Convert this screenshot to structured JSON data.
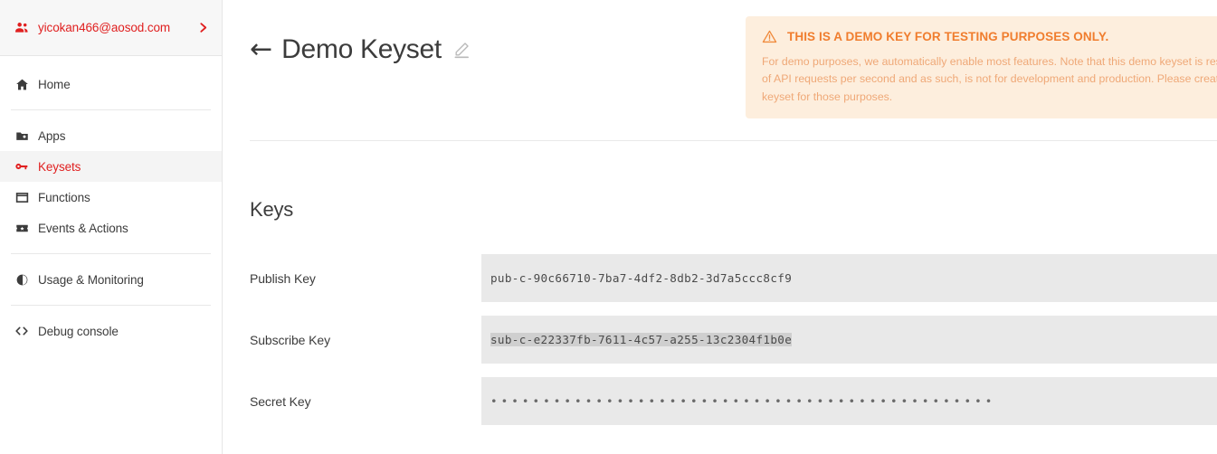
{
  "sidebar": {
    "account": {
      "icon": "people-icon",
      "email": "yicokan466@aosod.com",
      "chevron": "chevron-right-icon"
    },
    "items": [
      {
        "label": "Home",
        "icon": "home-icon",
        "active": false
      },
      {
        "label": "Apps",
        "icon": "folder-icon",
        "active": false
      },
      {
        "label": "Keysets",
        "icon": "key-icon",
        "active": true
      },
      {
        "label": "Functions",
        "icon": "window-icon",
        "active": false
      },
      {
        "label": "Events & Actions",
        "icon": "events-icon",
        "active": false
      },
      {
        "label": "Usage & Monitoring",
        "icon": "pie-chart-icon",
        "active": false
      },
      {
        "label": "Debug console",
        "icon": "code-brackets-icon",
        "active": false
      }
    ]
  },
  "main": {
    "back_arrow": "←",
    "page_title": "Demo Keyset",
    "edit_icon": "pencil-icon",
    "banner": {
      "icon": "warning-triangle-icon",
      "title": "THIS IS A DEMO KEY FOR TESTING PURPOSES ONLY.",
      "body": "For demo purposes, we automatically enable most features. Note that this demo keyset is restricted to a certain number of API requests per second and as such, is not for development and production. Please create a new application and keyset for those purposes."
    },
    "section_title": "Keys",
    "keys": [
      {
        "label": "Publish Key",
        "value": "pub-c-90c66710-7ba7-4df2-8db2-3d7a5ccc8cf9",
        "selected": false,
        "masked": false
      },
      {
        "label": "Subscribe Key",
        "value": "sub-c-e22337fb-7611-4c57-a255-13c2304f1b0e",
        "selected": true,
        "masked": false
      },
      {
        "label": "Secret Key",
        "value": "••••••••••••••••••••••••••••••••••••••••••••••••",
        "selected": false,
        "masked": true
      }
    ]
  },
  "colors": {
    "brand_red": "#e02020",
    "banner_bg": "#fdeedd",
    "banner_title": "#f07d2e",
    "banner_body": "#efa877",
    "field_bg": "#e9e9e9",
    "selection": "#cfcfcf"
  }
}
